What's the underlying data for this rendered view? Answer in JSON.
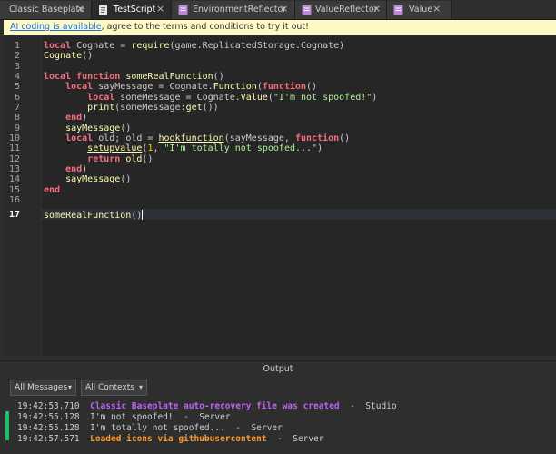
{
  "tabs": [
    {
      "label": "Classic Baseplate",
      "icon": "place-icon",
      "active": false
    },
    {
      "label": "TestScript",
      "icon": "script-icon",
      "active": true
    },
    {
      "label": "EnvironmentReflector",
      "icon": "module-script-icon",
      "active": false
    },
    {
      "label": "ValueReflector",
      "icon": "module-script-icon",
      "active": false
    },
    {
      "label": "Value",
      "icon": "module-script-icon",
      "active": false
    }
  ],
  "close_glyph": "×",
  "banner": {
    "link_text": "AI coding is available",
    "rest_text": ", agree to the terms and conditions to try it out!"
  },
  "editor": {
    "line_numbers": [
      "1",
      "2",
      "3",
      "4",
      "5",
      "6",
      "7",
      "8",
      "9",
      "10",
      "11",
      "12",
      "13",
      "14",
      "15",
      "16",
      "17"
    ],
    "current_line": "17"
  },
  "output": {
    "title": "Output",
    "filter_messages": "All Messages",
    "filter_contexts": "All Contexts",
    "logs": [
      {
        "time": "19:42:53.710",
        "message": "Classic Baseplate auto-recovery file was created",
        "source": "Studio",
        "style": "purple"
      },
      {
        "time": "19:42:55.128",
        "message": "I'm not spoofed!",
        "source": "Server",
        "style": "normal"
      },
      {
        "time": "19:42:55.128",
        "message": "I'm totally not spoofed...",
        "source": "Server",
        "style": "normal"
      },
      {
        "time": "19:42:57.571",
        "message": "Loaded icons via githubusercontent",
        "source": "Server",
        "style": "orange"
      }
    ],
    "separator": "-"
  },
  "colors": {
    "keyword": "#f86d7c",
    "string": "#adf195",
    "number": "#ffc600",
    "function": "#fdfbac",
    "log_purple": "#c060f5",
    "log_orange": "#ff9a2b",
    "active_bar": "#1fbe6c"
  }
}
